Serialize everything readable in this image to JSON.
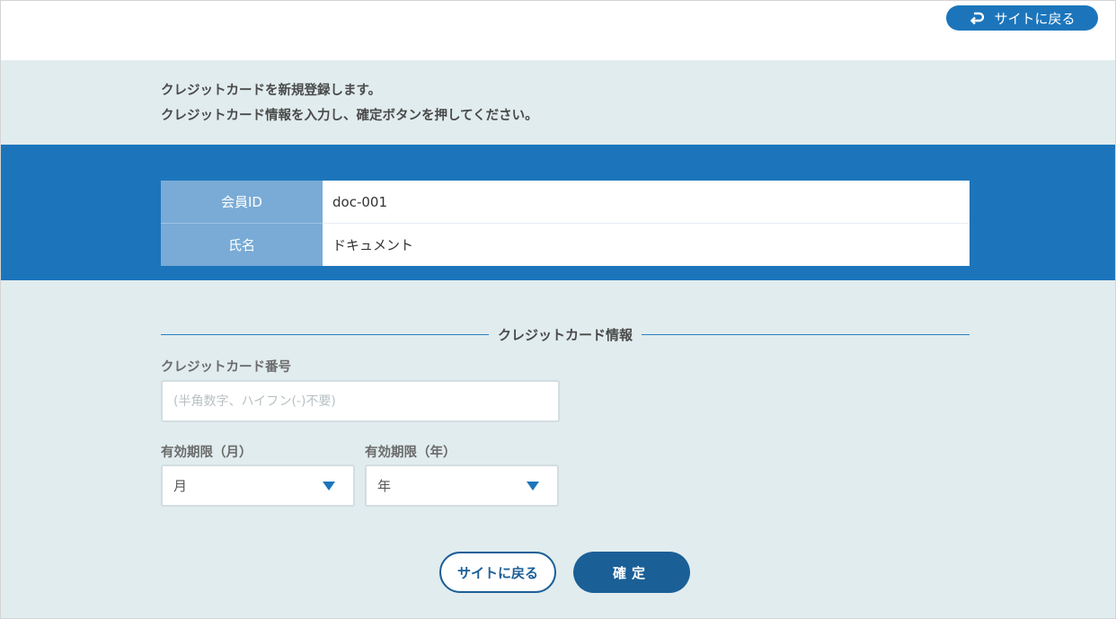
{
  "header": {
    "back_label": "サイトに戻る"
  },
  "intro": {
    "line1": "クレジットカードを新規登録します。",
    "line2": "クレジットカード情報を入力し、確定ボタンを押してください。"
  },
  "member": {
    "rows": [
      {
        "label": "会員ID",
        "value": "doc-001"
      },
      {
        "label": "氏名",
        "value": "ドキュメント"
      }
    ]
  },
  "card_section": {
    "title": "クレジットカード情報",
    "number_label": "クレジットカード番号",
    "number_placeholder": "(半角数字、ハイフン(-)不要)",
    "number_value": "",
    "month_label": "有効期限（月）",
    "month_selected": "月",
    "year_label": "有効期限（年）",
    "year_selected": "年"
  },
  "actions": {
    "back_label": "サイトに戻る",
    "confirm_label": "確定"
  },
  "colors": {
    "primary": "#1c75bb",
    "dark_button": "#1b5f97",
    "background": "#e1ecee",
    "label_cell": "#79abd6"
  },
  "icons": {
    "header_back": "return-arrow-icon",
    "select_arrow": "triangle-down-icon"
  }
}
